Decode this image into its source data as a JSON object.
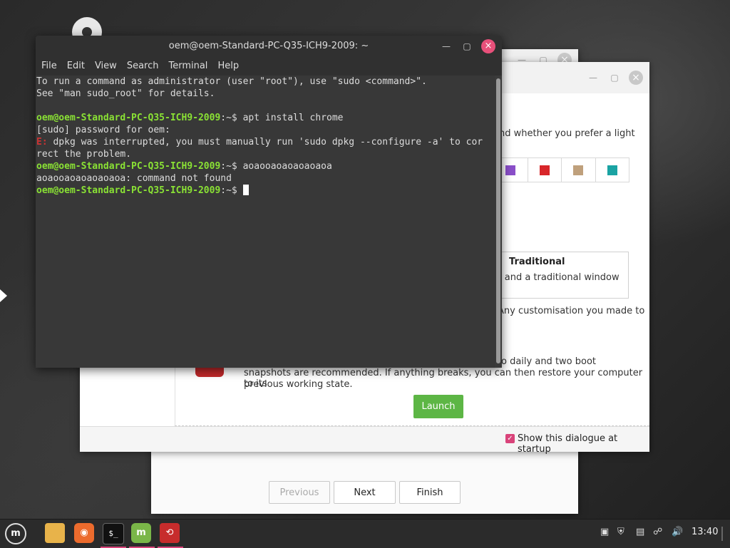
{
  "terminal": {
    "title": "oem@oem-Standard-PC-Q35-ICH9-2009: ~",
    "menu": [
      "File",
      "Edit",
      "View",
      "Search",
      "Terminal",
      "Help"
    ],
    "lines": {
      "l1": "To run a command as administrator (user \"root\"), use \"sudo <command>\".",
      "l2": "See \"man sudo_root\" for details.",
      "prompt_user": "oem@oem-Standard-PC-Q35-ICH9-2009",
      "prompt_path": ":~$ ",
      "cmd1": "apt install chrome",
      "l4": "[sudo] password for oem:",
      "err_tag": "E:",
      "l5": " dpkg was interrupted, you must manually run 'sudo dpkg --configure -a' to cor",
      "l6": "rect the problem.",
      "cmd2": "aoaooaoaoaoaoaoa",
      "l8": "aoaooaoaoaoaoaoa: command not found"
    }
  },
  "welcome": {
    "text_color_pref": "nd whether you prefer a light",
    "layout_title": "Traditional",
    "layout_desc": "el and a traditional window",
    "customisation": "Any customisation you made to",
    "timeshift_line1": "o daily and two boot",
    "timeshift_line2": "snapshots are recommended. If anything breaks, you can then restore your computer to its",
    "timeshift_line3": "previous working state.",
    "launch_label": "Launch",
    "show_startup": "Show this dialogue at startup",
    "swatch_colors": [
      "#8a4fc9",
      "#d8262a",
      "#bfa07c",
      "#1aa3a3"
    ]
  },
  "installer": {
    "previous": "Previous",
    "next": "Next",
    "finish": "Finish"
  },
  "taskbar": {
    "clock": "13:40"
  }
}
